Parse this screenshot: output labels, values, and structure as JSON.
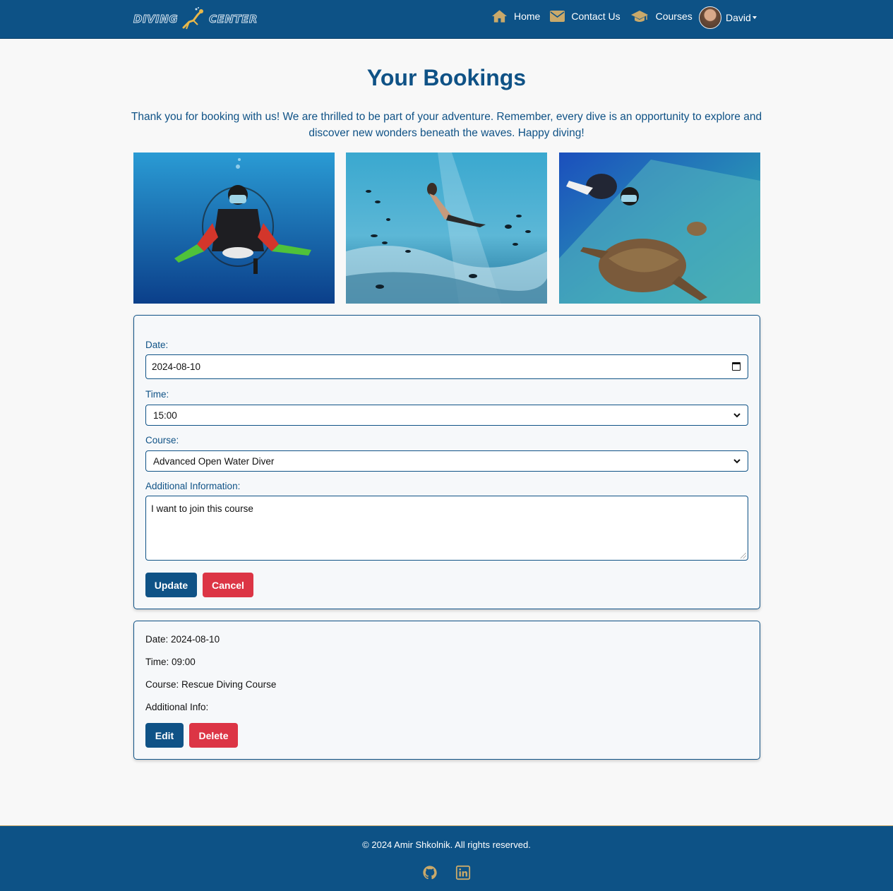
{
  "nav": {
    "logo_left": "DIVING",
    "logo_right": "CENTER",
    "home_label": "Home",
    "contact_label": "Contact Us",
    "courses_label": "Courses",
    "user_name": "David"
  },
  "colors": {
    "primary": "#0f5286",
    "accent": "#c9a96a",
    "danger": "#dc3545",
    "background": "#f8f8f8"
  },
  "header": {
    "title": "Your Bookings",
    "intro": "Thank you for booking with us! We are thrilled to be part of your adventure. Remember, every dive is an opportunity to explore and discover new wonders beneath the waves. Happy diving!"
  },
  "photos": [
    "scuba-diver-photo",
    "snorkeler-with-fish-photo",
    "diver-with-turtle-photo"
  ],
  "form": {
    "date_label": "Date:",
    "date_value": "2024-08-10",
    "time_label": "Time:",
    "time_value": "15:00",
    "course_label": "Course:",
    "course_value": "Advanced Open Water Diver",
    "info_label": "Additional Information:",
    "info_value": "I want to join this course",
    "update_label": "Update",
    "cancel_label": "Cancel"
  },
  "booking": {
    "date": "Date: 2024-08-10",
    "time": "Time: 09:00",
    "course": "Course: Rescue Diving Course",
    "info": "Additional Info:",
    "edit_label": "Edit",
    "delete_label": "Delete"
  },
  "footer": {
    "copyright": "© 2024 Amir Shkolnik. All rights reserved.",
    "icons": [
      "github-icon",
      "linkedin-icon"
    ]
  }
}
